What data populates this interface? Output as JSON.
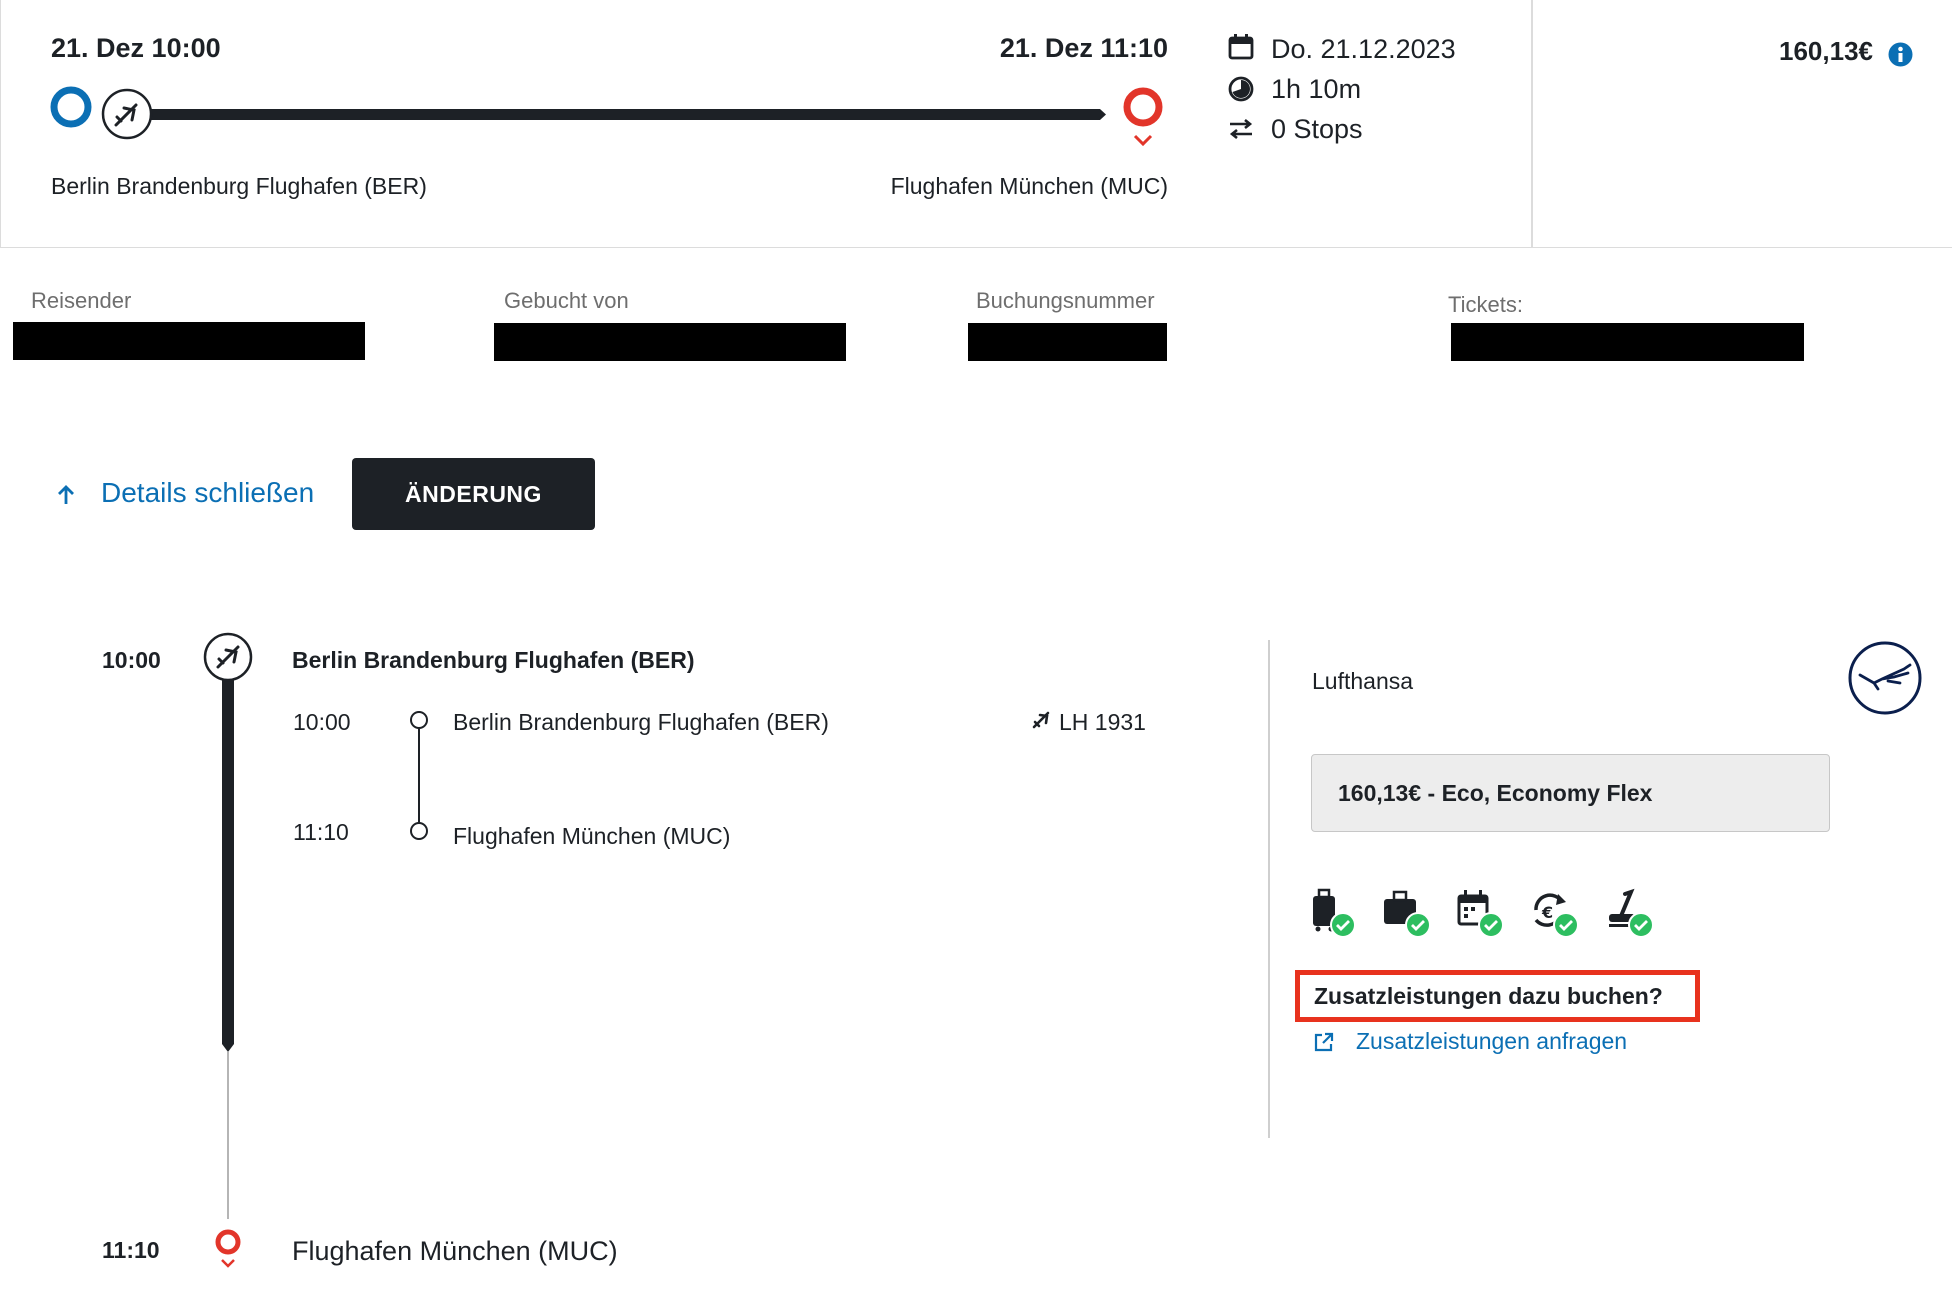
{
  "summary": {
    "departure_datetime": "21. Dez 10:00",
    "arrival_datetime": "21. Dez 11:10",
    "origin": "Berlin Brandenburg Flughafen (BER)",
    "destination": "Flughafen München (MUC)",
    "date": "Do. 21.12.2023",
    "duration": "1h 10m",
    "stops": "0 Stops",
    "price": "160,13€"
  },
  "traveler_info": {
    "traveler_label": "Reisender",
    "booked_by_label": "Gebucht von",
    "booking_number_label": "Buchungsnummer",
    "tickets_label": "Tickets:"
  },
  "actions": {
    "close_details": "Details schließen",
    "change_button": "ÄNDERUNG"
  },
  "itinerary": {
    "start_time": "10:00",
    "start_airport": "Berlin Brandenburg Flughafen (BER)",
    "segment": {
      "dep_time": "10:00",
      "dep_airport": "Berlin Brandenburg Flughafen (BER)",
      "arr_time": "11:10",
      "arr_airport": "Flughafen München (MUC)",
      "flight_number": "LH 1931"
    },
    "end_time": "11:10",
    "end_airport": "Flughafen München (MUC)"
  },
  "fare": {
    "airline": "Lufthansa",
    "fare_label": "160,13€ - Eco, Economy Flex",
    "amenity_icons": [
      "carry-on-bag-icon",
      "checked-bag-icon",
      "rebooking-calendar-icon",
      "refund-euro-icon",
      "seat-selection-icon"
    ],
    "extras_question": "Zusatzleistungen dazu buchen?",
    "extras_link": "Zusatzleistungen anfragen"
  },
  "colors": {
    "dark": "#1d2126",
    "accent_blue": "#0b6fb4",
    "destination_red": "#e2352a",
    "check_green": "#2dbe60",
    "highlight_red": "#e8321e"
  }
}
